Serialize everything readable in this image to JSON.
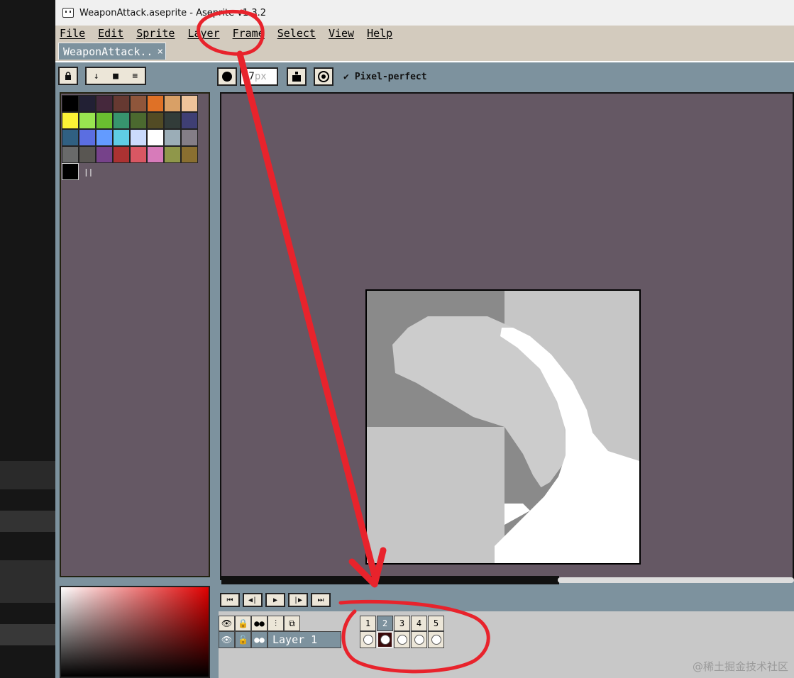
{
  "window": {
    "title": "WeaponAttack.aseprite - Aseprite v1.3.2"
  },
  "menu": [
    "File",
    "Edit",
    "Sprite",
    "Layer",
    "Frame",
    "Select",
    "View",
    "Help"
  ],
  "tab": {
    "label": "WeaponAttack..",
    "close": "×"
  },
  "palette_tools": {
    "lock": "lock-icon",
    "down": "↓",
    "stop": "■",
    "menu": "≡"
  },
  "palette": {
    "colors": [
      "#000000",
      "#222034",
      "#45283c",
      "#663931",
      "#8f563b",
      "#df7126",
      "#d9a066",
      "#eec39a",
      "#fbf236",
      "#99e550",
      "#6abe30",
      "#37946e",
      "#4b692f",
      "#524b24",
      "#323c39",
      "#3f3f74",
      "#306082",
      "#5b6ee1",
      "#639bff",
      "#5fcde4",
      "#cbdbfc",
      "#ffffff",
      "#9badb7",
      "#847e87",
      "#696a6a",
      "#595652",
      "#76428a",
      "#ac3232",
      "#d95763",
      "#d77bba",
      "#8f974a",
      "#8a6f30"
    ],
    "fg_color": "#000000",
    "size_mark": "||"
  },
  "context_bar": {
    "size_value": "27",
    "size_unit": "px",
    "pixel_perfect_label": "Pixel-perfect",
    "checkmark": "✔"
  },
  "timeline": {
    "play_buttons": [
      "⏮",
      "◀|",
      "▶",
      "|▶",
      "⏭"
    ],
    "header_icons": [
      "eye-icon",
      "lock-icon",
      "onion-icon",
      "link-icon",
      "layers-icon"
    ],
    "layer": {
      "name": "Layer 1"
    },
    "frames": [
      "1",
      "2",
      "3",
      "4",
      "5"
    ],
    "selected_frame": "2"
  },
  "watermark": "@稀土掘金技术社区",
  "annotation_color": "#e8232c"
}
